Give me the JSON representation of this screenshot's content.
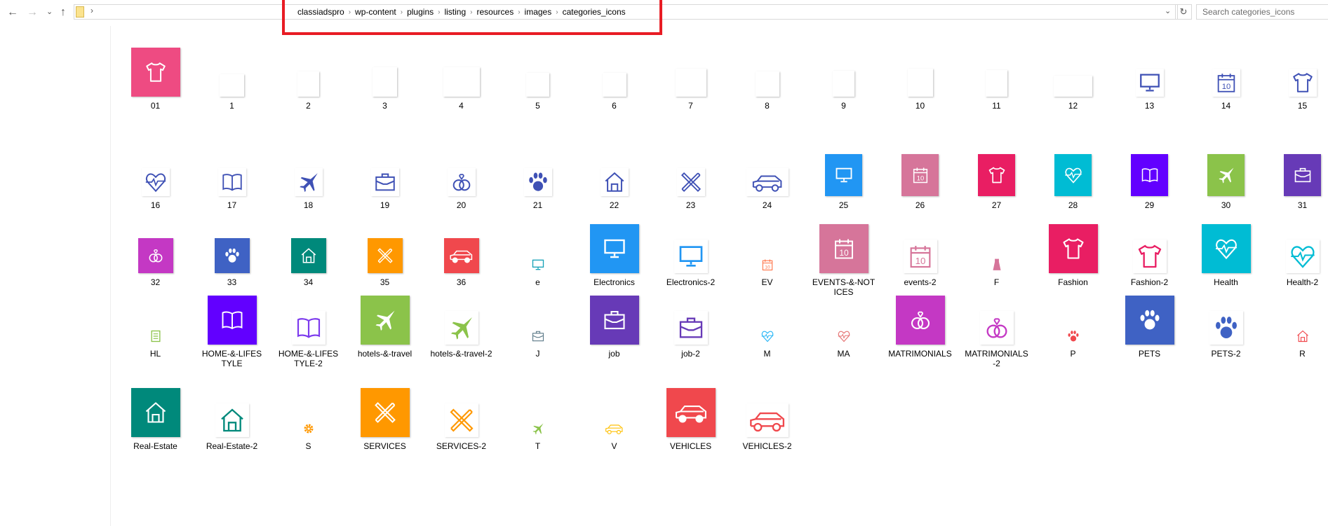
{
  "window": {
    "nav": {
      "back": "←",
      "forward": "→",
      "recent": "⌄",
      "up": "↑",
      "sep": "›"
    },
    "breadcrumb": [
      "classiadspro",
      "wp-content",
      "plugins",
      "listing",
      "resources",
      "images",
      "categories_icons"
    ],
    "breadcrumb_separator": "›",
    "address_dropdown": "⌄",
    "refresh": "↻",
    "search_placeholder": "Search categories_icons"
  },
  "files": [
    {
      "label": "01",
      "icon": "tshirt",
      "style": "filled",
      "color": "#EE4B82"
    },
    {
      "label": "1",
      "icon": "blank",
      "style": "blank",
      "color": "#ffffff"
    },
    {
      "label": "2",
      "icon": "blank",
      "style": "blank",
      "color": "#ffffff"
    },
    {
      "label": "3",
      "icon": "blank",
      "style": "blank",
      "color": "#ffffff"
    },
    {
      "label": "4",
      "icon": "blank",
      "style": "blank",
      "color": "#ffffff"
    },
    {
      "label": "5",
      "icon": "blank",
      "style": "blank",
      "color": "#ffffff"
    },
    {
      "label": "6",
      "icon": "blank",
      "style": "blank",
      "color": "#ffffff"
    },
    {
      "label": "7",
      "icon": "blank",
      "style": "blank",
      "color": "#ffffff"
    },
    {
      "label": "8",
      "icon": "blank",
      "style": "blank",
      "color": "#ffffff"
    },
    {
      "label": "9",
      "icon": "blank",
      "style": "blank",
      "color": "#ffffff"
    },
    {
      "label": "10",
      "icon": "blank",
      "style": "blank",
      "color": "#ffffff"
    },
    {
      "label": "11",
      "icon": "blank",
      "style": "blank",
      "color": "#ffffff"
    },
    {
      "label": "12",
      "icon": "blank",
      "style": "blank",
      "color": "#ffffff"
    },
    {
      "label": "13",
      "icon": "monitor",
      "style": "outline",
      "color": "#3F51B5"
    },
    {
      "label": "14",
      "icon": "calendar",
      "style": "outline",
      "color": "#3F51B5"
    },
    {
      "label": "15",
      "icon": "tshirt",
      "style": "outline",
      "color": "#3F51B5"
    },
    {
      "label": "16",
      "icon": "heart",
      "style": "outline",
      "color": "#3F51B5"
    },
    {
      "label": "17",
      "icon": "book",
      "style": "outline",
      "color": "#3F51B5"
    },
    {
      "label": "18",
      "icon": "plane",
      "style": "outline",
      "color": "#3F51B5"
    },
    {
      "label": "19",
      "icon": "briefcase",
      "style": "outline",
      "color": "#3F51B5"
    },
    {
      "label": "20",
      "icon": "rings",
      "style": "outline",
      "color": "#3F51B5"
    },
    {
      "label": "21",
      "icon": "paw",
      "style": "outline",
      "color": "#3F51B5"
    },
    {
      "label": "22",
      "icon": "house",
      "style": "outline",
      "color": "#3F51B5"
    },
    {
      "label": "23",
      "icon": "tools",
      "style": "outline",
      "color": "#3F51B5"
    },
    {
      "label": "24",
      "icon": "car",
      "style": "outline",
      "color": "#3F51B5"
    },
    {
      "label": "25",
      "icon": "monitor",
      "style": "filled",
      "color": "#2196F3"
    },
    {
      "label": "26",
      "icon": "calendar",
      "style": "filled",
      "color": "#D6759A"
    },
    {
      "label": "27",
      "icon": "tshirt",
      "style": "filled",
      "color": "#E91E63"
    },
    {
      "label": "28",
      "icon": "heart",
      "style": "filled",
      "color": "#00BCD4"
    },
    {
      "label": "29",
      "icon": "book",
      "style": "filled",
      "color": "#6200FF"
    },
    {
      "label": "30",
      "icon": "plane",
      "style": "filled",
      "color": "#8BC34A"
    },
    {
      "label": "31",
      "icon": "briefcase",
      "style": "filled",
      "color": "#673AB7"
    },
    {
      "label": "32",
      "icon": "rings",
      "style": "filled",
      "color": "#C438C4"
    },
    {
      "label": "33",
      "icon": "paw",
      "style": "filled",
      "color": "#3F62C4"
    },
    {
      "label": "34",
      "icon": "house",
      "style": "filled",
      "color": "#00897B"
    },
    {
      "label": "35",
      "icon": "tools",
      "style": "filled",
      "color": "#FF9800"
    },
    {
      "label": "36",
      "icon": "car",
      "style": "filled",
      "color": "#F0484D"
    },
    {
      "label": "e",
      "icon": "monitor",
      "style": "small",
      "color": "#17A2B8"
    },
    {
      "label": "Electronics",
      "icon": "monitor",
      "style": "filled",
      "color": "#2196F3"
    },
    {
      "label": "Electronics-2",
      "icon": "monitor",
      "style": "outline",
      "color": "#2196F3"
    },
    {
      "label": "EV",
      "icon": "calendar",
      "style": "small",
      "color": "#FF7043"
    },
    {
      "label": "EVENTS-&-NOTICES",
      "icon": "calendar",
      "style": "filled",
      "color": "#D6759A"
    },
    {
      "label": "events-2",
      "icon": "calendar",
      "style": "outline",
      "color": "#D6759A"
    },
    {
      "label": "F",
      "icon": "dress",
      "style": "small",
      "color": "#D6759A"
    },
    {
      "label": "Fashion",
      "icon": "tshirt",
      "style": "filled",
      "color": "#E91E63"
    },
    {
      "label": "Fashion-2",
      "icon": "tshirt",
      "style": "outline",
      "color": "#E91E63"
    },
    {
      "label": "Health",
      "icon": "heart",
      "style": "filled",
      "color": "#00BCD4"
    },
    {
      "label": "Health-2",
      "icon": "heart",
      "style": "outline",
      "color": "#00BCD4"
    },
    {
      "label": "HL",
      "icon": "document",
      "style": "small",
      "color": "#8BC34A"
    },
    {
      "label": "HOME-&-LIFESTYLE",
      "icon": "book",
      "style": "filled",
      "color": "#6200FF"
    },
    {
      "label": "HOME-&-LIFESTYLE-2",
      "icon": "book",
      "style": "outline",
      "color": "#7C3AED"
    },
    {
      "label": "hotels-&-travel",
      "icon": "plane",
      "style": "filled",
      "color": "#8BC34A"
    },
    {
      "label": "hotels-&-travel-2",
      "icon": "plane",
      "style": "outline",
      "color": "#8BC34A"
    },
    {
      "label": "J",
      "icon": "briefcase",
      "style": "small",
      "color": "#607D8B"
    },
    {
      "label": "job",
      "icon": "briefcase",
      "style": "filled",
      "color": "#673AB7"
    },
    {
      "label": "job-2",
      "icon": "briefcase",
      "style": "outline",
      "color": "#673AB7"
    },
    {
      "label": "M",
      "icon": "heart",
      "style": "small",
      "color": "#29B6F6"
    },
    {
      "label": "MA",
      "icon": "heart",
      "style": "small",
      "color": "#E57373"
    },
    {
      "label": "MATRIMONIALS",
      "icon": "rings",
      "style": "filled",
      "color": "#C438C4"
    },
    {
      "label": "MATRIMONIALS-2",
      "icon": "rings",
      "style": "outline",
      "color": "#C438C4"
    },
    {
      "label": "P",
      "icon": "paw",
      "style": "small",
      "color": "#F0484D"
    },
    {
      "label": "PETS",
      "icon": "paw",
      "style": "filled",
      "color": "#3F62C4"
    },
    {
      "label": "PETS-2",
      "icon": "paw",
      "style": "outline",
      "color": "#3F62C4"
    },
    {
      "label": "R",
      "icon": "house",
      "style": "small",
      "color": "#F0484D"
    },
    {
      "label": "Real-Estate",
      "icon": "house",
      "style": "filled",
      "color": "#00897B"
    },
    {
      "label": "Real-Estate-2",
      "icon": "house",
      "style": "outline",
      "color": "#00897B"
    },
    {
      "label": "S",
      "icon": "gear",
      "style": "small",
      "color": "#FF9800"
    },
    {
      "label": "SERVICES",
      "icon": "tools",
      "style": "filled",
      "color": "#FF9800"
    },
    {
      "label": "SERVICES-2",
      "icon": "tools",
      "style": "outline",
      "color": "#FF9800"
    },
    {
      "label": "T",
      "icon": "plane",
      "style": "small",
      "color": "#8BC34A"
    },
    {
      "label": "V",
      "icon": "car",
      "style": "small",
      "color": "#FFC107"
    },
    {
      "label": "VEHICLES",
      "icon": "car",
      "style": "filled",
      "color": "#F0484D"
    },
    {
      "label": "VEHICLES-2",
      "icon": "car",
      "style": "outline",
      "color": "#F0484D"
    }
  ]
}
